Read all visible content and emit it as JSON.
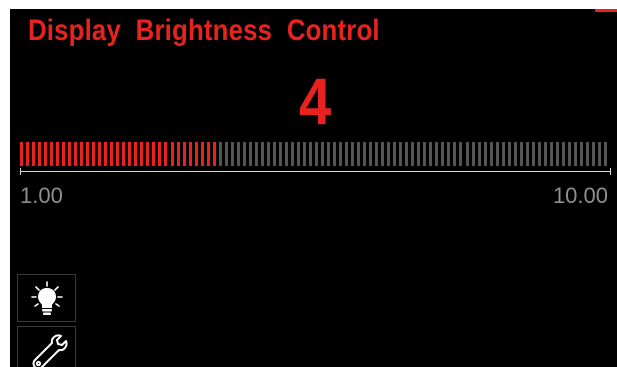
{
  "screen": {
    "title": "Display  Brightness  Control",
    "current_value": "4",
    "range_min_label": "1.00",
    "range_max_label": "10.00"
  },
  "meter": {
    "segment_count": 98,
    "active_segments": 33,
    "active_color": "#e8231f",
    "inactive_color": "#555555"
  },
  "sidebar": {
    "items": [
      {
        "icon": "lightbulb-icon"
      },
      {
        "icon": "wrench-icon"
      }
    ]
  },
  "colors": {
    "accent": "#e8231f",
    "background": "#000000",
    "muted_text": "#8f8f8f"
  }
}
